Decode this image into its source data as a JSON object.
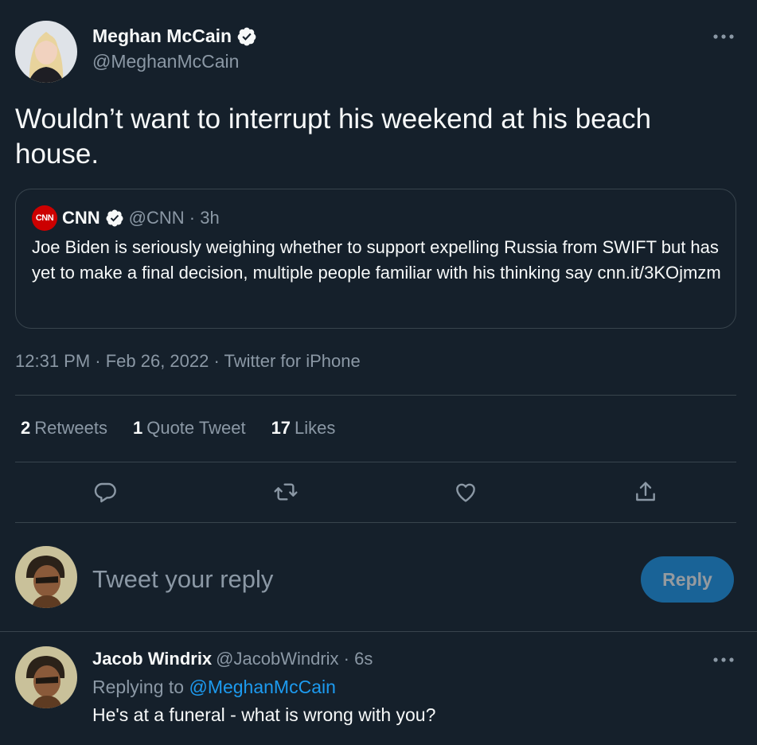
{
  "main_tweet": {
    "author_name": "Meghan McCain",
    "author_handle": "@MeghanMcCain",
    "text": "Wouldn’t want to interrupt his weekend at his beach house.",
    "timestamp": "12:31 PM · Feb 26, 2022 · Twitter for iPhone",
    "avatar_icon": "profile-photo-blonde-woman"
  },
  "quoted_tweet": {
    "logo_text": "CNN",
    "author_name": "CNN",
    "meta": "@CNN · 3h",
    "text": "Joe Biden is seriously weighing whether to support expelling Russia from SWIFT but has yet to make a final decision, multiple people familiar with his thinking say cnn.it/3KOjmzm"
  },
  "stats": {
    "retweets_count": "2",
    "retweets_label": "Retweets",
    "quotes_count": "1",
    "quotes_label": "Quote Tweet",
    "likes_count": "17",
    "likes_label": "Likes"
  },
  "actions": [
    "reply-icon",
    "retweet-icon",
    "like-icon",
    "share-icon"
  ],
  "composer": {
    "placeholder": "Tweet your reply",
    "button_label": "Reply"
  },
  "reply_tweet": {
    "author_name": "Jacob Windrix",
    "meta": "@JacobWindrix · 6s",
    "replying_prefix": "Replying to",
    "replying_handle": "@MeghanMcCain",
    "text": "He's at a funeral - what is wrong with you?",
    "avatar_icon": "profile-photo-illustrated-character"
  },
  "colors": {
    "background": "#15202b",
    "accent": "#1d9bf0",
    "secondary_text": "#8b98a5",
    "divider": "#38444d",
    "cnn_red": "#cc0000"
  }
}
